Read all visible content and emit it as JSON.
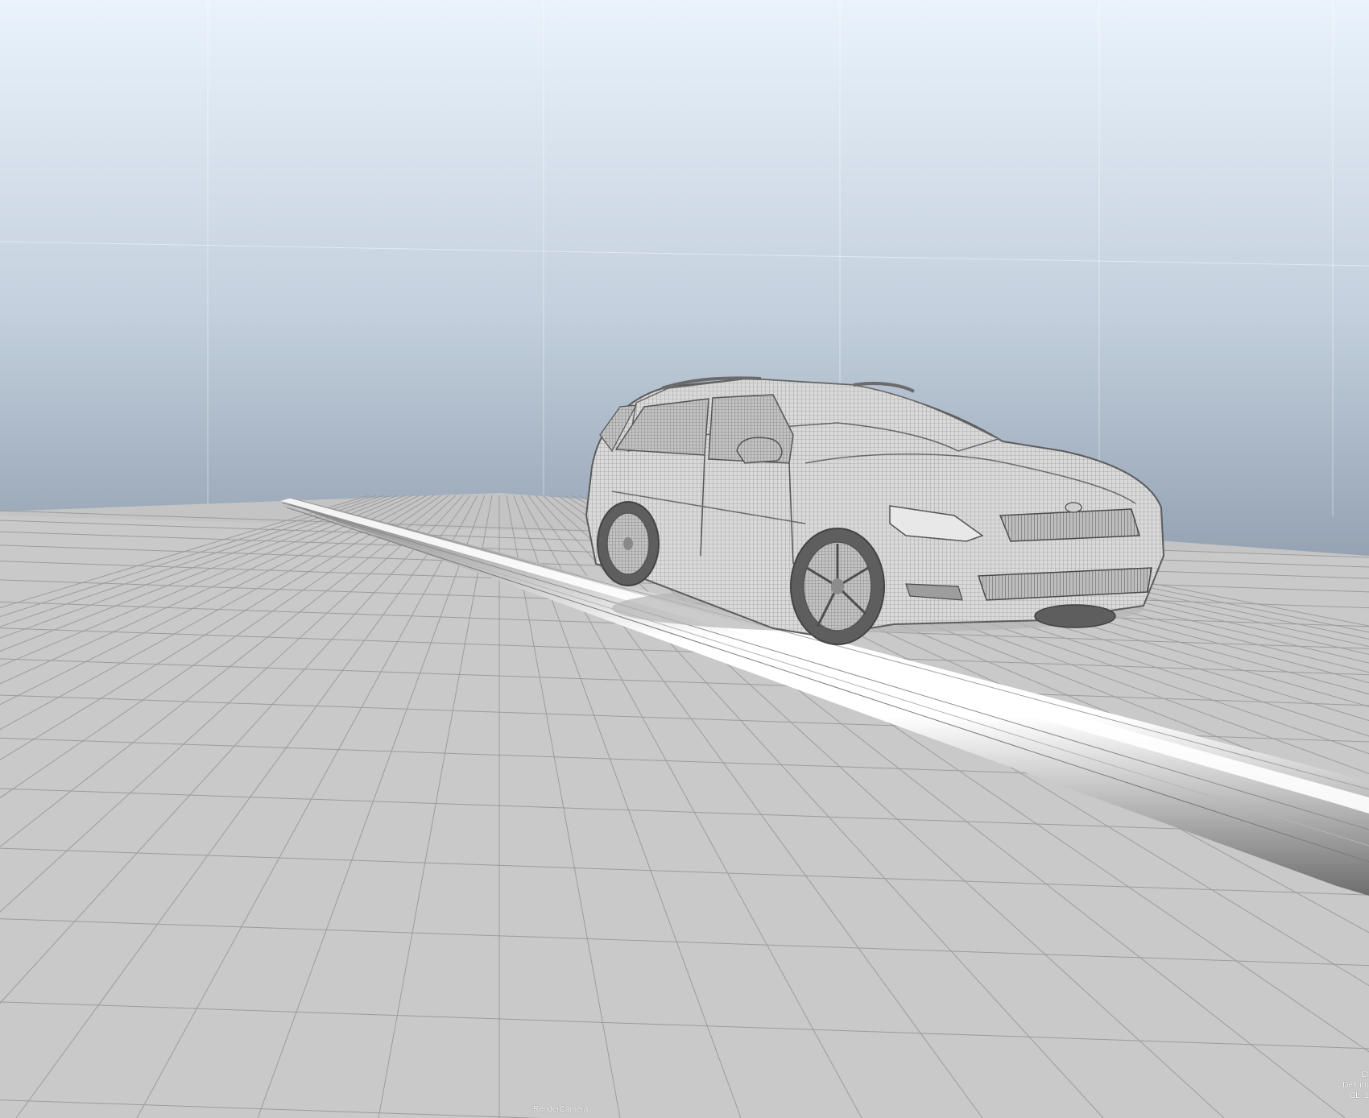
{
  "viewport": {
    "camera_label": "RenderCamera",
    "stats": [
      "Cl",
      "Deform",
      "GL: 1"
    ],
    "colors": {
      "sky_top": "#eaf3fc",
      "sky_bottom": "#93a1b2",
      "floor": "#c9c9c9",
      "grid_line": "#9a9a9a",
      "mesh_fill": "#d6d6d6",
      "mesh_line": "#6a6a6a",
      "tube_highlight": "#ffffff"
    }
  },
  "scene": {
    "objects": [
      "car-wireframe-model",
      "tube-rail-mesh",
      "ground-grid"
    ]
  }
}
